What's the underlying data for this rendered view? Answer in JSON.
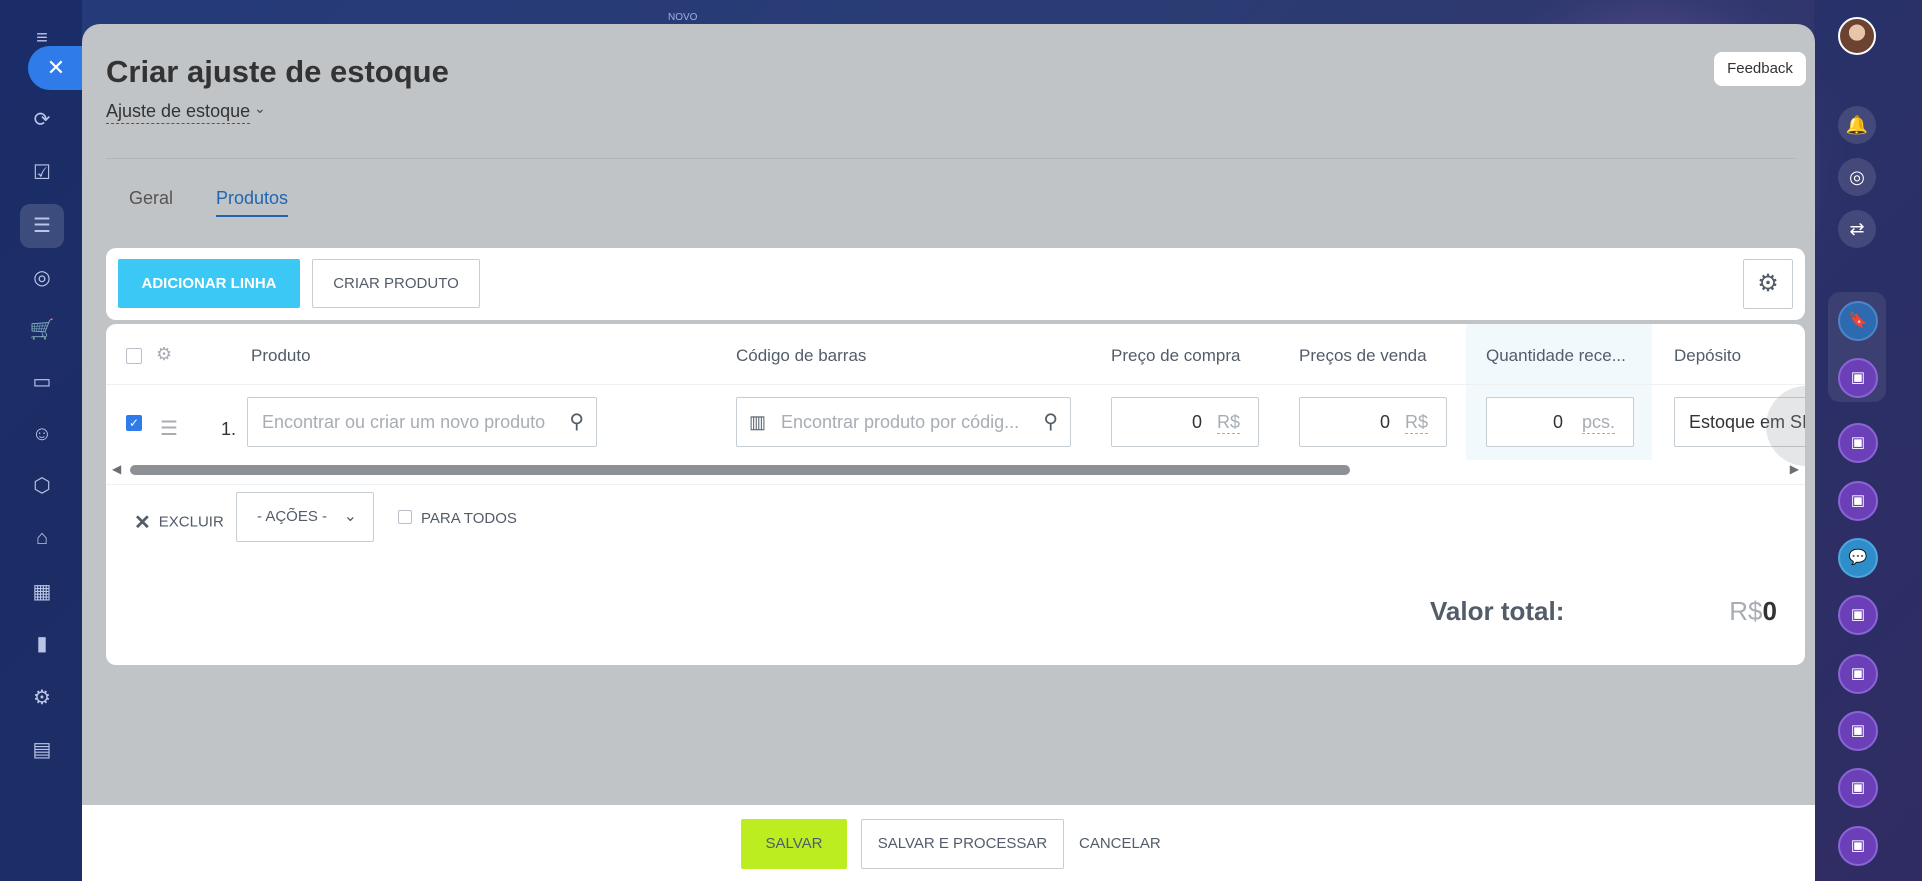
{
  "header": {
    "title": "Criar ajuste de estoque",
    "document_type": "Ajuste de estoque",
    "feedback_label": "Feedback",
    "new_badge": "NOVO"
  },
  "tabs": [
    {
      "label": "Geral",
      "active": false
    },
    {
      "label": "Produtos",
      "active": true
    }
  ],
  "toolbar": {
    "add_line_label": "ADICIONAR LINHA",
    "create_product_label": "CRIAR PRODUTO"
  },
  "table": {
    "columns": [
      "Produto",
      "Código de barras",
      "Preço de compra",
      "Preços de venda",
      "Quantidade rece...",
      "Depósito"
    ],
    "rows": [
      {
        "number": "1.",
        "checked": true,
        "product_placeholder": "Encontrar ou criar um novo produto",
        "barcode_placeholder": "Encontrar produto por códig...",
        "purchase_price": "0",
        "purchase_currency": "R$",
        "sale_price": "0",
        "sale_currency": "R$",
        "quantity": "0",
        "quantity_unit": "pcs.",
        "warehouse": "Estoque em SP"
      }
    ]
  },
  "bulk": {
    "delete_label": "EXCLUIR",
    "actions_label": "- AÇÕES -",
    "for_all_label": "PARA TODOS"
  },
  "total": {
    "label": "Valor total:",
    "currency": "R$",
    "value": "0"
  },
  "footer": {
    "save_label": "SALVAR",
    "save_process_label": "SALVAR E PROCESSAR",
    "cancel_label": "CANCELAR"
  },
  "colors": {
    "accent_blue": "#3bc8f5",
    "save_green": "#bbed21",
    "tab_active": "#2066b0",
    "overlay_gray": "#c1c4c6"
  }
}
